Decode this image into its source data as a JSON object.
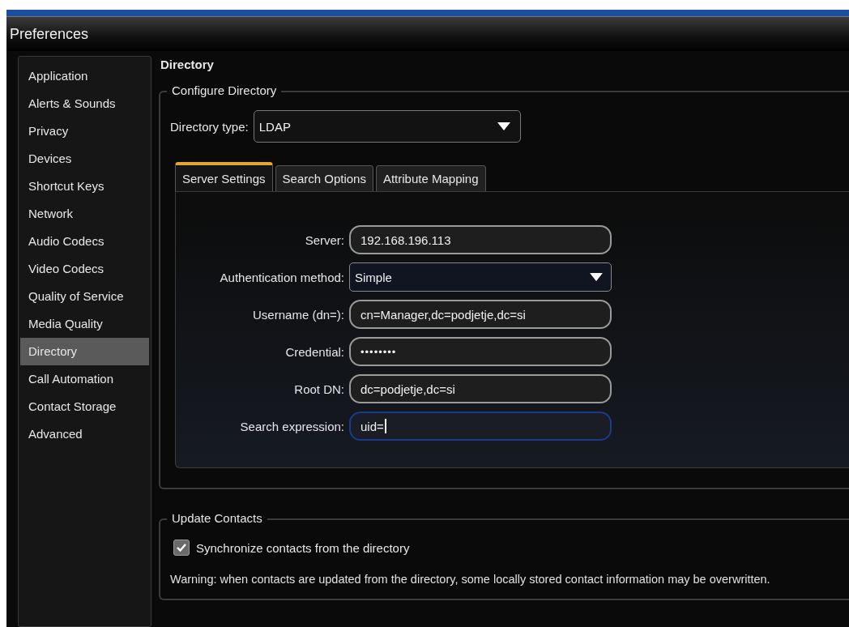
{
  "window": {
    "title": "Preferences"
  },
  "sidebar": {
    "items": [
      {
        "label": "Application",
        "selected": false
      },
      {
        "label": "Alerts & Sounds",
        "selected": false
      },
      {
        "label": "Privacy",
        "selected": false
      },
      {
        "label": "Devices",
        "selected": false
      },
      {
        "label": "Shortcut Keys",
        "selected": false
      },
      {
        "label": "Network",
        "selected": false
      },
      {
        "label": "Audio Codecs",
        "selected": false
      },
      {
        "label": "Video Codecs",
        "selected": false
      },
      {
        "label": "Quality of Service",
        "selected": false
      },
      {
        "label": "Media Quality",
        "selected": false
      },
      {
        "label": "Directory",
        "selected": true
      },
      {
        "label": "Call Automation",
        "selected": false
      },
      {
        "label": "Contact Storage",
        "selected": false
      },
      {
        "label": "Advanced",
        "selected": false
      }
    ]
  },
  "page": {
    "title": "Directory",
    "configure": {
      "legend": "Configure Directory",
      "directory_type": {
        "label": "Directory type:",
        "value": "LDAP"
      },
      "tabs": [
        {
          "label": "Server Settings",
          "selected": true
        },
        {
          "label": "Search Options",
          "selected": false
        },
        {
          "label": "Attribute Mapping",
          "selected": false
        }
      ],
      "fields": [
        {
          "kind": "text",
          "label": "Server:",
          "value": "192.168.196.113",
          "focused": false
        },
        {
          "kind": "dropdown",
          "label": "Authentication method:",
          "value": "Simple",
          "focused": false
        },
        {
          "kind": "text",
          "label": "Username (dn=):",
          "value": "cn=Manager,dc=podjetje,dc=si",
          "focused": false
        },
        {
          "kind": "password",
          "label": "Credential:",
          "value": "••••••••",
          "focused": false
        },
        {
          "kind": "text",
          "label": "Root DN:",
          "value": "dc=podjetje,dc=si",
          "focused": false
        },
        {
          "kind": "text",
          "label": "Search expression:",
          "value": "uid=",
          "focused": true
        }
      ]
    },
    "update": {
      "legend": "Update Contacts",
      "checkbox": {
        "label": "Synchronize contacts from the directory",
        "checked": true
      },
      "warning": "Warning: when contacts are updated from the directory, some locally stored contact information may be overwritten."
    }
  }
}
